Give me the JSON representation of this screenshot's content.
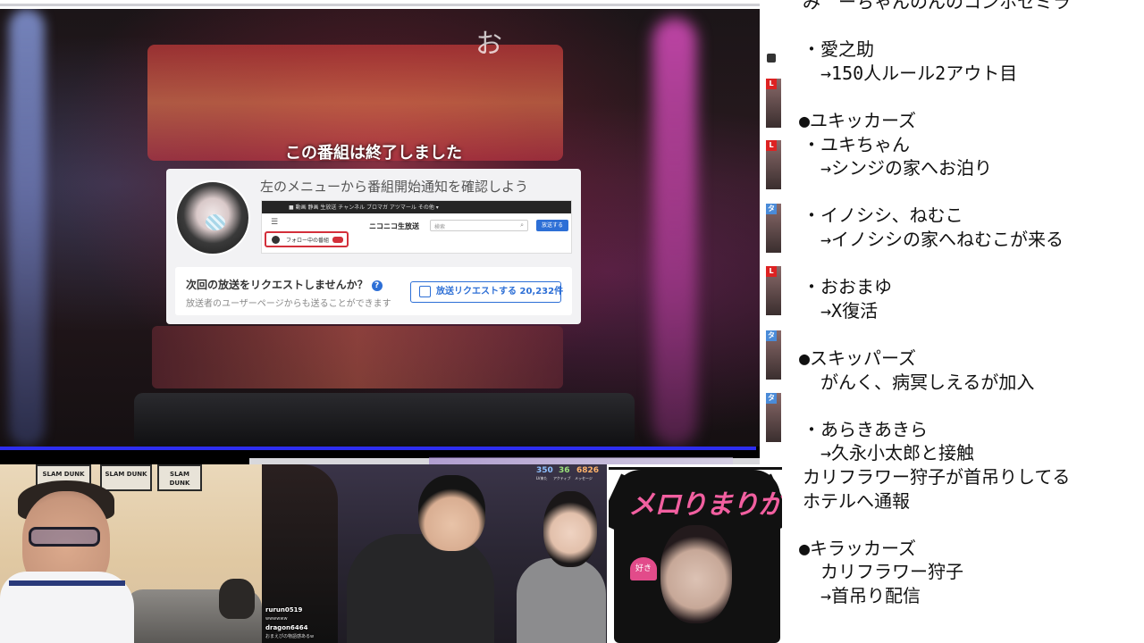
{
  "player": {
    "overlay_glyph": "お",
    "ended_message": "この番組は終了しました"
  },
  "card": {
    "headline": "左のメニューから番組開始通知を確認しよう",
    "mini_nav": "■  動画  静画  生放送  チャンネル  ブロマガ  アツマール  その他 ▾",
    "mini_follow_label": "フォロー中の番組",
    "mini_brand": "ニコニコ生放送",
    "mini_search_placeholder": "検索",
    "mini_search_button": "放送する",
    "request_question": "次回の放送をリクエストしませんか？",
    "request_help": "?",
    "request_sub": "放送者のユーザーページからも送ることができます",
    "request_button": "放送リクエストする 20,232件"
  },
  "strip": {
    "tags": [
      "L",
      "L",
      "タ",
      "L",
      "タ",
      "タ"
    ]
  },
  "notes": {
    "lines": [
      "  み゛ーちゃんのんのコンホセミラ",
      "",
      "  ・愛之助",
      "→150人ルール2アウト目",
      "",
      "●ユキッカーズ",
      "  ・ユキちゃん",
      "→シンジの家へお泊り",
      "",
      "  ・イノシシ、ねむこ",
      "→イノシシの家へねむこが来る",
      "",
      "  ・おおまゆ",
      "→X復活",
      "",
      "●スキッパーズ",
      "がんく、病冥しえるが加入",
      "",
      "  ・あらきあきら",
      "→久永小太郎と接触",
      "  カリフラワー狩子が首吊りしてる",
      "  ホテルへ通報",
      "",
      "●キラッカーズ",
      "カリフラワー狩子",
      "→首吊り配信"
    ]
  },
  "cam1": {
    "posters": [
      "SLAM DUNK",
      "SLAM DUNK",
      "SLAM DUNK"
    ]
  },
  "cam2": {
    "stats": [
      {
        "value": "350",
        "label": "LV来た",
        "color": "#8ec0ff"
      },
      {
        "value": "36",
        "label": "アクティブ",
        "color": "#9be27a"
      },
      {
        "value": "6826",
        "label": "メッセージ",
        "color": "#ffb36b"
      }
    ],
    "chat": [
      {
        "user": "rurun0519",
        "text": "wwwwww"
      },
      {
        "user": "dragon6464",
        "text": "おまえぴの物語感あるw"
      }
    ]
  },
  "cam3": {
    "shirt_title": "メロりまりか",
    "heart_text": "好き"
  }
}
